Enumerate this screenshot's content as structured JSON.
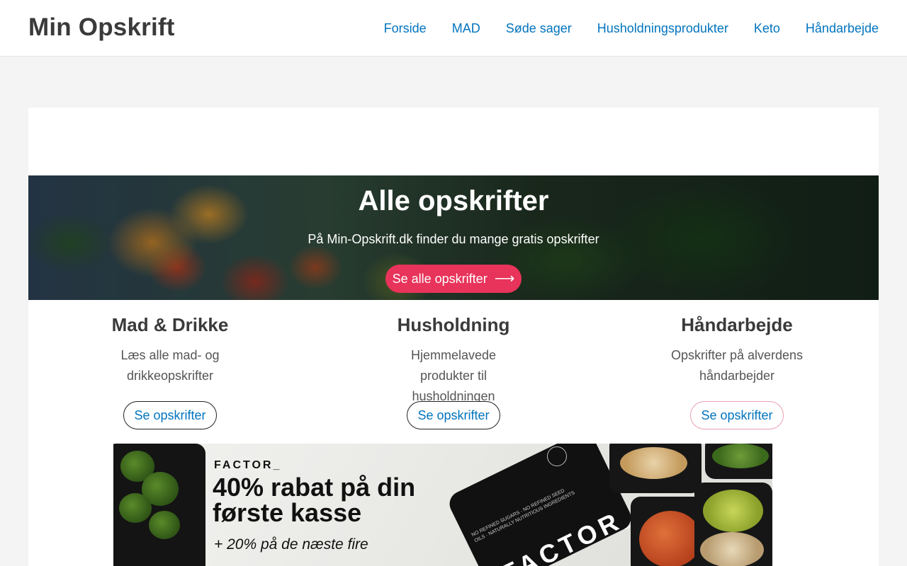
{
  "header": {
    "logo": "Min Opskrift",
    "nav": [
      {
        "label": "Forside"
      },
      {
        "label": "MAD"
      },
      {
        "label": "Søde sager"
      },
      {
        "label": "Husholdningsprodukter"
      },
      {
        "label": "Keto"
      },
      {
        "label": "Håndarbejde"
      }
    ]
  },
  "hero": {
    "title": "Alle opskrifter",
    "subtitle": "På Min-Opskrift.dk finder du mange gratis opskrifter",
    "button_label": "Se alle opskrifter",
    "button_icon": "arrow-right-icon",
    "button_color": "#e8335a"
  },
  "categories": [
    {
      "title": "Mad & Drikke",
      "description": "Læs alle mad- og drikkeopskrifter",
      "button_label": "Se opskrifter"
    },
    {
      "title": "Husholdning",
      "description": "Hjemmelavede produkter til husholdningen",
      "button_label": "Se opskrifter"
    },
    {
      "title": "Håndarbejde",
      "description": "Opskrifter på alverdens håndarbejder",
      "button_label": "Se opskrifter"
    }
  ],
  "ad": {
    "brand": "FACTOR_",
    "headline": "40% rabat på din første kasse",
    "subline": "+ 20% på de næste fire",
    "card_text": "NO REFINED SUGARS · NO REFINED SEED OILS · NATURALLY NUTRITIOUS INGREDIENTS",
    "card_logo": "FACTOR_"
  },
  "colors": {
    "link": "#0274be",
    "text": "#3a3a3a",
    "background": "#f4f4f4"
  }
}
